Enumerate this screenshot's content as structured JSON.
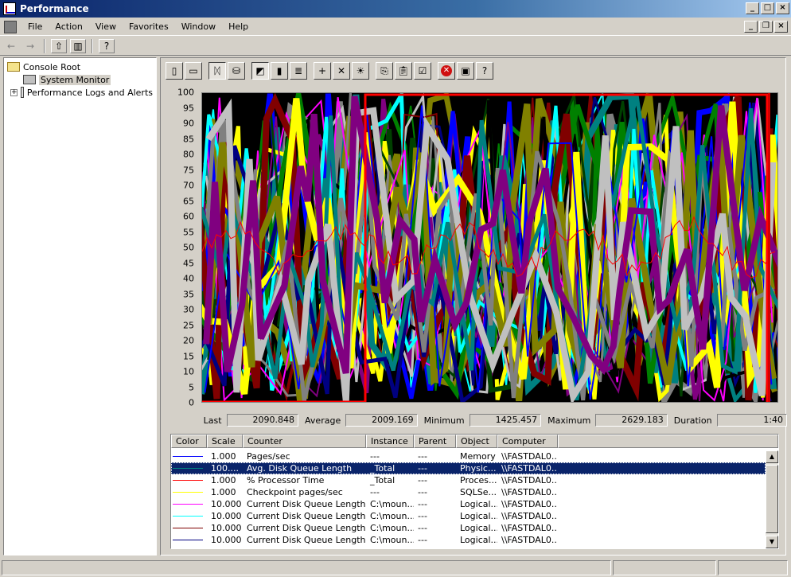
{
  "window": {
    "title": "Performance"
  },
  "menu": [
    {
      "label": "File",
      "accel": "F",
      "rest": "ile"
    },
    {
      "label": "Action",
      "accel": "A",
      "rest": "ction"
    },
    {
      "label": "View",
      "accel": "V",
      "rest": "iew"
    },
    {
      "label": "Favorites",
      "accel": "o",
      "pre": "Fav",
      "rest": "rites"
    },
    {
      "label": "Window",
      "accel": "W",
      "rest": "indow"
    },
    {
      "label": "Help",
      "accel": "H",
      "rest": "elp"
    }
  ],
  "tree": {
    "root": "Console Root",
    "system_monitor": "System Monitor",
    "perf_logs": "Performance Logs and Alerts",
    "expander": "+"
  },
  "yaxis": [
    100,
    95,
    90,
    85,
    80,
    75,
    70,
    65,
    60,
    55,
    50,
    45,
    40,
    35,
    30,
    25,
    20,
    15,
    10,
    5,
    0
  ],
  "stats": {
    "last_label": "Last",
    "last": "2090.848",
    "average_label": "Average",
    "average": "2009.169",
    "minimum_label": "Minimum",
    "minimum": "1425.457",
    "maximum_label": "Maximum",
    "maximum": "2629.183",
    "duration_label": "Duration",
    "duration": "1:40"
  },
  "legend": {
    "columns": [
      "Color",
      "Scale",
      "Counter",
      "Instance",
      "Parent",
      "Object",
      "Computer"
    ],
    "rows": [
      {
        "color": "#0000ff",
        "scale": "1.000",
        "counter": "Pages/sec",
        "instance": "---",
        "parent": "---",
        "object": "Memory",
        "computer": "\\\\FASTDAL0..."
      },
      {
        "color": "#008080",
        "scale": "100....",
        "counter": "Avg. Disk Queue Length",
        "instance": "_Total",
        "parent": "---",
        "object": "Physic...",
        "computer": "\\\\FASTDAL0...",
        "selected": true
      },
      {
        "color": "#ff0000",
        "scale": "1.000",
        "counter": "% Processor Time",
        "instance": "_Total",
        "parent": "---",
        "object": "Proces...",
        "computer": "\\\\FASTDAL0..."
      },
      {
        "color": "#ffff00",
        "scale": "1.000",
        "counter": "Checkpoint pages/sec",
        "instance": "---",
        "parent": "---",
        "object": "SQLSe...",
        "computer": "\\\\FASTDAL0..."
      },
      {
        "color": "#ff00ff",
        "scale": "10.000",
        "counter": "Current Disk Queue Length",
        "instance": "C:\\moun...",
        "parent": "---",
        "object": "Logical...",
        "computer": "\\\\FASTDAL0..."
      },
      {
        "color": "#00ffff",
        "scale": "10.000",
        "counter": "Current Disk Queue Length",
        "instance": "C:\\moun...",
        "parent": "---",
        "object": "Logical...",
        "computer": "\\\\FASTDAL0..."
      },
      {
        "color": "#800000",
        "scale": "10.000",
        "counter": "Current Disk Queue Length",
        "instance": "C:\\moun...",
        "parent": "---",
        "object": "Logical...",
        "computer": "\\\\FASTDAL0..."
      },
      {
        "color": "#000080",
        "scale": "10.000",
        "counter": "Current Disk Queue Length",
        "instance": "C:\\moun...",
        "parent": "---",
        "object": "Logical...",
        "computer": "\\\\FASTDAL0..."
      }
    ]
  },
  "colors": {
    "series_palette": [
      "#008000",
      "#ff00ff",
      "#00ffff",
      "#800000",
      "#000080",
      "#ffff00",
      "#808000",
      "#0000ff",
      "#808080",
      "#008080",
      "#c0c0c0",
      "#800080",
      "#004000",
      "#000000"
    ],
    "processor_line": "#ff0000",
    "pages_line": "#ff0000"
  },
  "icons": {
    "toolbar": [
      "back-arrow-icon",
      "forward-arrow-icon",
      "up-folder-icon",
      "show-tree-icon",
      "help-icon"
    ],
    "monitor_toolbar": [
      "new-counter-set-icon",
      "clear-display-icon",
      "view-current-activity-icon",
      "view-log-data-icon",
      "view-graph-icon",
      "view-histogram-icon",
      "view-report-icon",
      "add-counter-icon",
      "delete-counter-icon",
      "highlight-icon",
      "copy-properties-icon",
      "paste-counter-list-icon",
      "properties-icon",
      "freeze-display-icon",
      "update-data-icon",
      "help-icon"
    ]
  }
}
